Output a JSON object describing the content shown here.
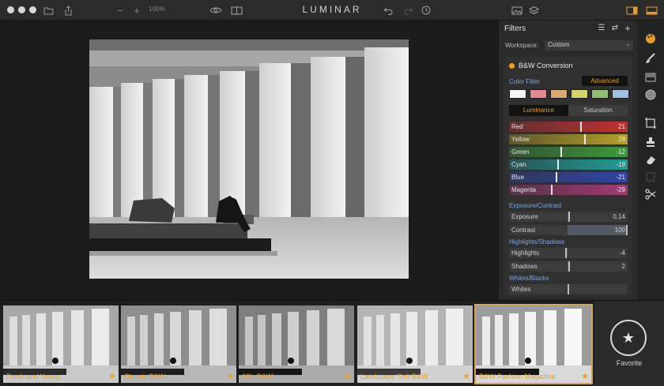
{
  "app": {
    "title": "LUMINAR",
    "zoom": "100%"
  },
  "panel": {
    "title": "Filters",
    "workspace_label": "Workspace:",
    "workspace_value": "Custom",
    "filter": {
      "name": "B&W Conversion",
      "color_filter_label": "Color Filter",
      "advanced_label": "Advanced",
      "swatches": [
        "#f4f4f4",
        "#e1898f",
        "#d7ab6e",
        "#d6d26a",
        "#8fbd71",
        "#9fc2e2"
      ],
      "tabs": [
        "Luminance",
        "Saturation"
      ],
      "color_sliders": [
        {
          "label": "Red",
          "value": "21",
          "level": 0.61,
          "color": "#c0312f"
        },
        {
          "label": "Yellow",
          "value": "28",
          "level": 0.64,
          "color": "#b3a128"
        },
        {
          "label": "Green",
          "value": "-12",
          "level": 0.44,
          "color": "#3c9a3a"
        },
        {
          "label": "Cyan",
          "value": "-19",
          "level": 0.41,
          "color": "#1f9d95"
        },
        {
          "label": "Blue",
          "value": "-21",
          "level": 0.4,
          "color": "#3144a8"
        },
        {
          "label": "Magenta",
          "value": "-29",
          "level": 0.36,
          "color": "#a23a75"
        }
      ],
      "sections": [
        {
          "title": "Exposure/Contrast",
          "sliders": [
            {
              "label": "Exposure",
              "value": "0.14",
              "level": 0.51
            },
            {
              "label": "Contrast",
              "value": "100",
              "level": 1.0
            }
          ]
        },
        {
          "title": "Highlights/Shadows",
          "sliders": [
            {
              "label": "Highlights",
              "value": "-4",
              "level": 0.48
            },
            {
              "label": "Shadows",
              "value": "2",
              "level": 0.51
            }
          ]
        },
        {
          "title": "Whites/Blacks",
          "sliders": [
            {
              "label": "Whites",
              "value": "",
              "level": 0.5
            }
          ]
        }
      ]
    }
  },
  "presets": [
    {
      "label": "Fresh and Young"
    },
    {
      "label": "Classic B&W"
    },
    {
      "label": "60's B&W"
    },
    {
      "label": "Landscape Soft B&W"
    },
    {
      "label": "B&W Fashion Magazine"
    }
  ],
  "favorite": {
    "label": "Favorite"
  }
}
